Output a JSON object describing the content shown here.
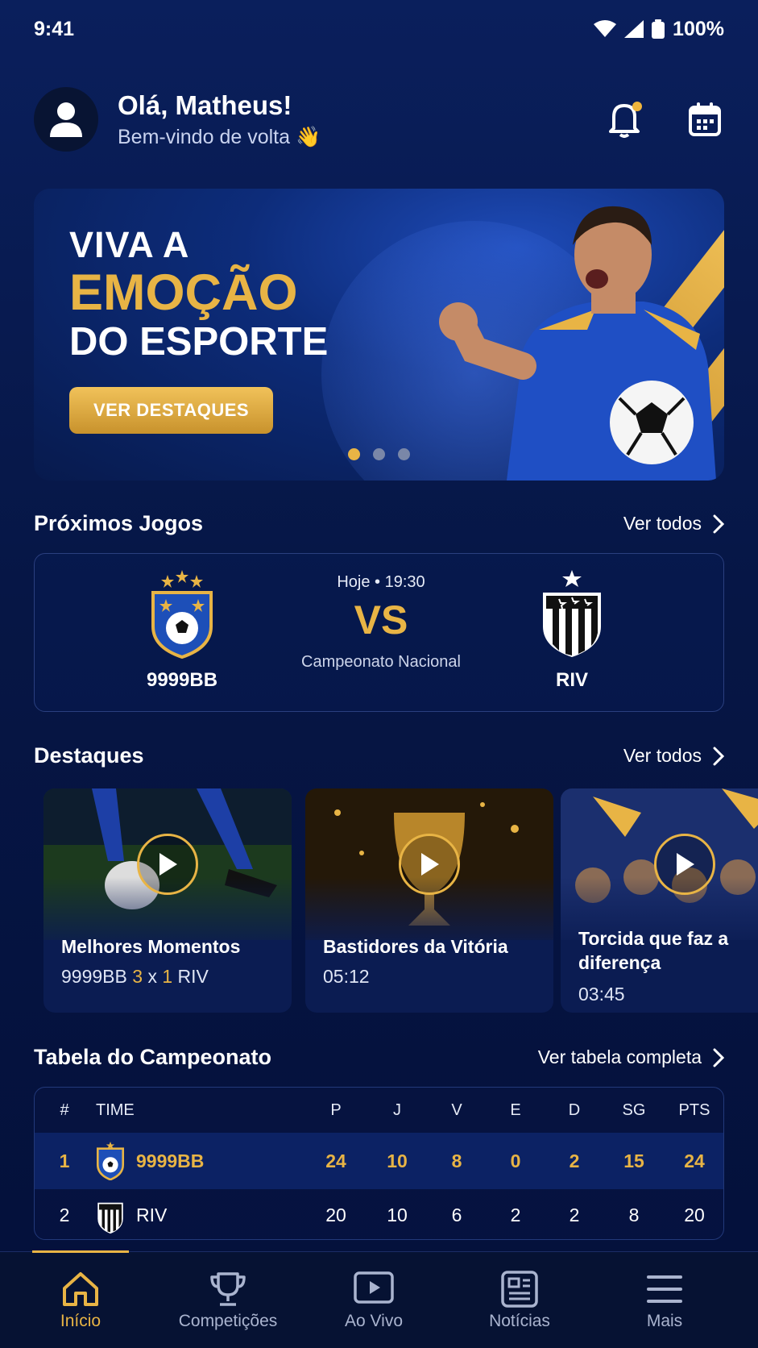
{
  "status": {
    "time": "9:41",
    "battery": "100%"
  },
  "header": {
    "greeting": "Olá, Matheus!",
    "subtitle": "Bem-vindo de volta 👋"
  },
  "hero": {
    "line1": "VIVA A",
    "line2": "EMOÇÃO",
    "line3": "DO ESPORTE",
    "button": "VER DESTAQUES",
    "slides": 3,
    "active_slide": 1
  },
  "upcoming": {
    "title": "Próximos Jogos",
    "link": "Ver todos",
    "match": {
      "home": "9999BB",
      "away": "RIV",
      "time": "Hoje • 19:30",
      "vs": "VS",
      "competition": "Campeonato Nacional"
    }
  },
  "highlights": {
    "title": "Destaques",
    "link": "Ver todos",
    "items": [
      {
        "title": "Melhores Momentos",
        "home": "9999BB",
        "home_score": "3",
        "sep": "x",
        "away_score": "1",
        "away": "RIV"
      },
      {
        "title": "Bastidores da Vitória",
        "duration": "05:12"
      },
      {
        "title": "Torcida que faz a diferença",
        "duration": "03:45"
      }
    ]
  },
  "standings": {
    "title": "Tabela do Campeonato",
    "link": "Ver tabela completa",
    "columns": [
      "#",
      "TIME",
      "P",
      "J",
      "V",
      "E",
      "D",
      "SG",
      "PTS"
    ],
    "rows": [
      {
        "pos": "1",
        "team": "9999BB",
        "p": "24",
        "j": "10",
        "v": "8",
        "e": "0",
        "d": "2",
        "sg": "15",
        "pts": "24"
      },
      {
        "pos": "2",
        "team": "RIV",
        "p": "20",
        "j": "10",
        "v": "6",
        "e": "2",
        "d": "2",
        "sg": "8",
        "pts": "20"
      }
    ]
  },
  "nav": {
    "items": [
      {
        "label": "Início",
        "icon": "home-icon"
      },
      {
        "label": "Competições",
        "icon": "trophy-icon"
      },
      {
        "label": "Ao Vivo",
        "icon": "play-icon"
      },
      {
        "label": "Notícias",
        "icon": "news-icon"
      },
      {
        "label": "Mais",
        "icon": "menu-icon"
      }
    ],
    "active": "Início"
  },
  "colors": {
    "accent": "#e8b445",
    "background": "#061645",
    "card_border": "#2a3f7f"
  }
}
